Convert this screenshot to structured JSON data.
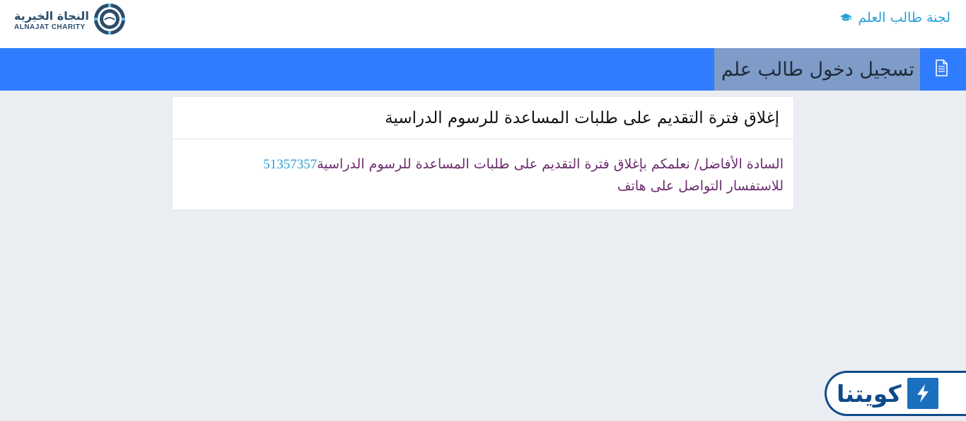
{
  "header": {
    "committee_link": "لجنة طالب العلم",
    "logo_ar": "النجاة الخيرية",
    "logo_en": "ALNAJAT CHARITY"
  },
  "page": {
    "title": "تسجيل دخول طالب علم"
  },
  "notice": {
    "title": "إغلاق فترة التقديم على طلبات المساعدة للرسوم الدراسية",
    "body_line1": "السادة الأفاضل/ نعلمكم بإغلاق فترة التقديم على طلبات المساعدة للرسوم الدراسية",
    "phone": "51357357",
    "body_line2": "للاستفسار التواصل على هاتف"
  },
  "watermark": {
    "text": "كويتنا"
  },
  "colors": {
    "accent": "#2f7cff",
    "link": "#2a9fd6",
    "body_text": "#6b2c6d",
    "background": "#eaedf2"
  },
  "icons": [
    "graduation-cap-icon",
    "document-icon",
    "charity-logo-icon",
    "lightning-icon"
  ]
}
